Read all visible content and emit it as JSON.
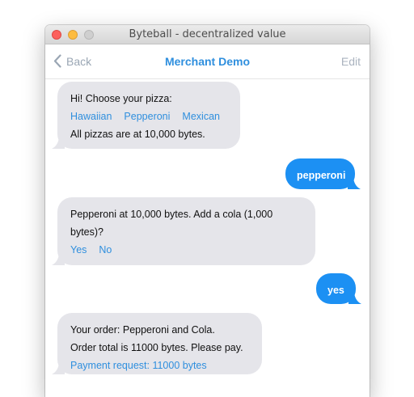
{
  "window": {
    "title": "Byteball - decentralized value"
  },
  "nav": {
    "back_label": "Back",
    "title": "Merchant Demo",
    "edit_label": "Edit"
  },
  "colors": {
    "accent": "#2f8fde",
    "outgoing_bubble": "#1c90f3",
    "incoming_bubble": "#e5e5ea"
  },
  "messages": [
    {
      "from": "merchant",
      "line1": "Hi! Choose your pizza:",
      "options": [
        "Hawaiian",
        "Pepperoni",
        "Mexican"
      ],
      "line2": "All pizzas are at 10,000 bytes."
    },
    {
      "from": "user",
      "text": "pepperoni"
    },
    {
      "from": "merchant",
      "line1": "Pepperoni at 10,000 bytes. Add a cola (1,000",
      "line2": "bytes)?",
      "options": [
        "Yes",
        "No"
      ]
    },
    {
      "from": "user",
      "text": "yes"
    },
    {
      "from": "merchant",
      "line1": "Your order: Pepperoni and Cola.",
      "line2": "Order total is 11000 bytes. Please pay.",
      "payment_link": "Payment request: 11000 bytes"
    }
  ]
}
